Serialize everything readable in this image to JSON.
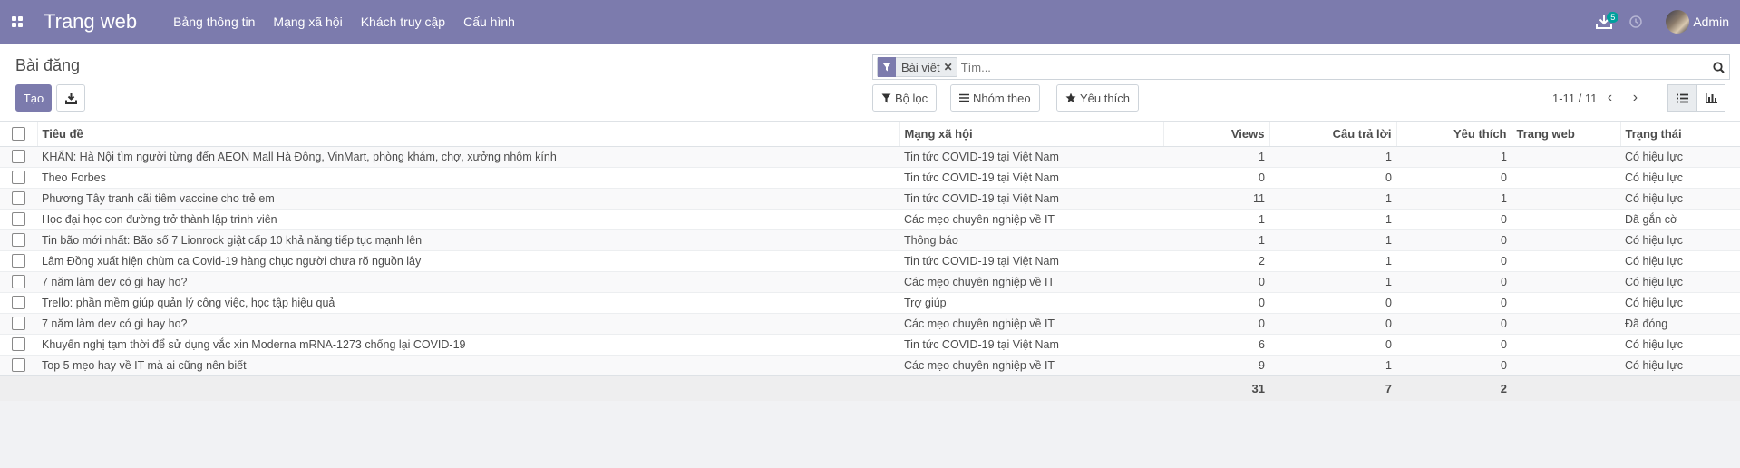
{
  "navbar": {
    "brand": "Trang web",
    "menu": [
      "Bảng thông tin",
      "Mạng xã hội",
      "Khách truy cập",
      "Cấu hình"
    ],
    "download_badge": "5",
    "user": "Admin",
    "color": "#7c7bad"
  },
  "control": {
    "breadcrumb": "Bài đăng",
    "create_label": "Tạo",
    "search": {
      "facet": "Bài viết",
      "placeholder": "Tìm..."
    },
    "filters_label": "Bộ lọc",
    "groupby_label": "Nhóm theo",
    "favorites_label": "Yêu thích",
    "pager": "1-11 / 11"
  },
  "table": {
    "headers": {
      "title": "Tiêu đề",
      "network": "Mạng xã hội",
      "views": "Views",
      "replies": "Câu trả lời",
      "likes": "Yêu thích",
      "website": "Trang web",
      "status": "Trạng thái"
    },
    "rows": [
      {
        "title": "KHẨN: Hà Nội tìm người từng đến AEON Mall Hà Đông, VinMart, phòng khám, chợ, xưởng nhôm kính",
        "network": "Tin tức COVID-19 tại Việt Nam",
        "views": "1",
        "replies": "1",
        "likes": "1",
        "website": "",
        "status": "Có hiệu lực"
      },
      {
        "title": "Theo Forbes",
        "network": "Tin tức COVID-19 tại Việt Nam",
        "views": "0",
        "replies": "0",
        "likes": "0",
        "website": "",
        "status": "Có hiệu lực"
      },
      {
        "title": "Phương Tây tranh cãi tiêm vaccine cho trẻ em",
        "network": "Tin tức COVID-19 tại Việt Nam",
        "views": "11",
        "replies": "1",
        "likes": "1",
        "website": "",
        "status": "Có hiệu lực"
      },
      {
        "title": "Học đại học con đường trở thành lập trình viên",
        "network": "Các mẹo chuyên nghiệp về IT",
        "views": "1",
        "replies": "1",
        "likes": "0",
        "website": "",
        "status": "Đã gắn cờ"
      },
      {
        "title": "Tin bão mới nhất: Bão số 7 Lionrock giật cấp 10 khả năng tiếp tục mạnh lên",
        "network": "Thông báo",
        "views": "1",
        "replies": "1",
        "likes": "0",
        "website": "",
        "status": "Có hiệu lực"
      },
      {
        "title": "Lâm Đồng xuất hiện chùm ca Covid-19 hàng chục người chưa rõ nguồn lây",
        "network": "Tin tức COVID-19 tại Việt Nam",
        "views": "2",
        "replies": "1",
        "likes": "0",
        "website": "",
        "status": "Có hiệu lực"
      },
      {
        "title": "7 năm làm dev có gì hay ho?",
        "network": "Các mẹo chuyên nghiệp về IT",
        "views": "0",
        "replies": "1",
        "likes": "0",
        "website": "",
        "status": "Có hiệu lực"
      },
      {
        "title": "Trello: phần mềm giúp quản lý công việc, học tập hiệu quả",
        "network": "Trợ giúp",
        "views": "0",
        "replies": "0",
        "likes": "0",
        "website": "",
        "status": "Có hiệu lực"
      },
      {
        "title": "7 năm làm dev có gì hay ho?",
        "network": "Các mẹo chuyên nghiệp về IT",
        "views": "0",
        "replies": "0",
        "likes": "0",
        "website": "",
        "status": "Đã đóng"
      },
      {
        "title": "Khuyến nghị tạm thời để sử dụng vắc xin Moderna mRNA-1273 chống lại COVID-19",
        "network": "Tin tức COVID-19 tại Việt Nam",
        "views": "6",
        "replies": "0",
        "likes": "0",
        "website": "",
        "status": "Có hiệu lực"
      },
      {
        "title": "Top 5 mẹo hay về IT mà ai cũng nên biết",
        "network": "Các mẹo chuyên nghiệp về IT",
        "views": "9",
        "replies": "1",
        "likes": "0",
        "website": "",
        "status": "Có hiệu lực"
      }
    ],
    "totals": {
      "views": "31",
      "replies": "7",
      "likes": "2"
    }
  }
}
